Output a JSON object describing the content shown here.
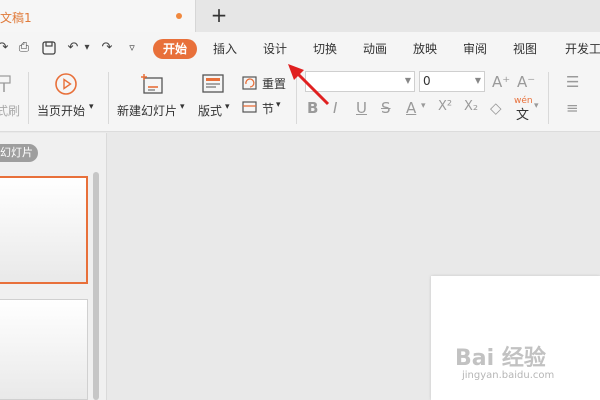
{
  "colors": {
    "accent": "#e8703a",
    "arrow": "#e02020",
    "dot": "#f0883e"
  },
  "document_tab": {
    "title": "文稿1",
    "new_tab_symbol": "+"
  },
  "quick_access": {
    "icons": [
      "redo-icon",
      "print-icon",
      "undo-icon",
      "dropdown-icon",
      "redo-arrow-icon",
      "customize-icon"
    ],
    "glyphs": [
      "↷",
      "⎙",
      "↶",
      "▾",
      "↷",
      "▿"
    ]
  },
  "menu": {
    "items": [
      {
        "label": "开始",
        "active": true
      },
      {
        "label": "插入"
      },
      {
        "label": "设计"
      },
      {
        "label": "切换"
      },
      {
        "label": "动画"
      },
      {
        "label": "放映"
      },
      {
        "label": "审阅"
      },
      {
        "label": "视图"
      },
      {
        "label": "开发工"
      }
    ]
  },
  "ribbon": {
    "format_brush_label": "式刷",
    "play_label": "当页开始",
    "play_dropdown": "▾",
    "new_slide_label": "新建幻灯片",
    "new_slide_dropdown": "▾",
    "layout_label": "版式",
    "layout_dropdown": "▾",
    "reset_label": "重置",
    "section_label": "节",
    "section_dropdown": "▾",
    "font_name_value": "",
    "font_size_value": "0",
    "grow_font": "A⁺",
    "shrink_font": "A⁻",
    "bold": "B",
    "italic": "I",
    "underline": "U",
    "strike": "S",
    "font_color": "A",
    "superscript": "X²",
    "subscript": "X₂",
    "clear_format": "◇",
    "phonetic": "wén",
    "phonetic_char": "文"
  },
  "side_panel": {
    "tab_label": "幻灯片"
  },
  "watermark": {
    "brand": "Bai 经验",
    "url": "jingyan.baidu.com"
  }
}
